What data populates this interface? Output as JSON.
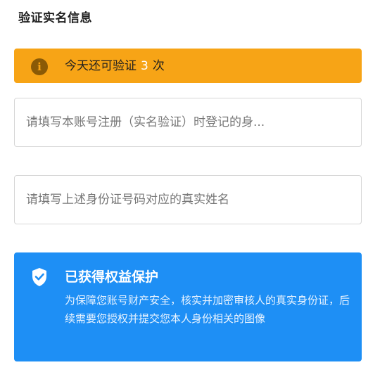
{
  "section": {
    "title": "验证实名信息"
  },
  "notice": {
    "prefix": "今天还可验证",
    "count": "3",
    "suffix": "次",
    "icon": "info-icon",
    "color": "#f7a416"
  },
  "form": {
    "id_number_placeholder": "请填写本账号注册（实名验证）时登记的身...",
    "name_placeholder": "请填写上述身份证号码对应的真实姓名",
    "id_number_value": "",
    "name_value": ""
  },
  "protection": {
    "icon": "shield-check-icon",
    "title": "已获得权益保护",
    "description": "为保障您账号财产安全，核实并加密审核人的真实身份证，后续需要您授权并提交您本人身份相关的图像",
    "color": "#1e8ff5"
  }
}
